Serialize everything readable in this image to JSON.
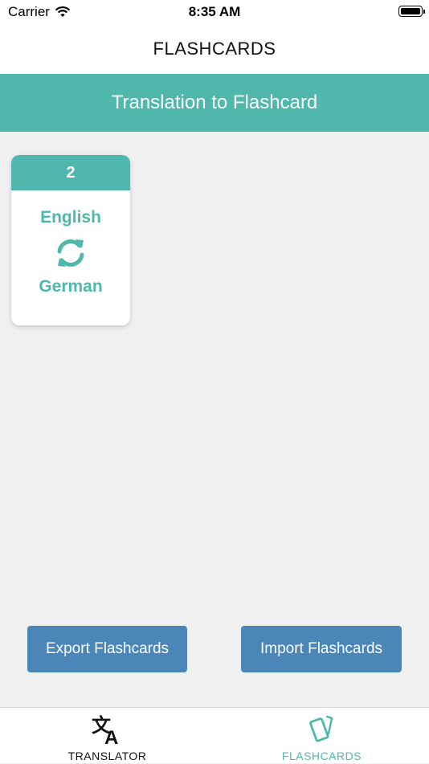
{
  "status_bar": {
    "carrier": "Carrier",
    "time": "8:35 AM"
  },
  "nav": {
    "title": "FLASHCARDS"
  },
  "banner": {
    "text": "Translation to Flashcard"
  },
  "decks": [
    {
      "count": "2",
      "source_language": "English",
      "target_language": "German",
      "icon": "swap-icon"
    }
  ],
  "actions": {
    "export_label": "Export Flashcards",
    "import_label": "Import Flashcards"
  },
  "tabs": [
    {
      "label": "TRANSLATOR",
      "icon": "translate-icon",
      "active": false
    },
    {
      "label": "FLASHCARDS",
      "icon": "flashcards-icon",
      "active": true
    }
  ],
  "colors": {
    "accent": "#4fb7ab",
    "button": "#4b86b9",
    "background": "#f0f0f0"
  }
}
